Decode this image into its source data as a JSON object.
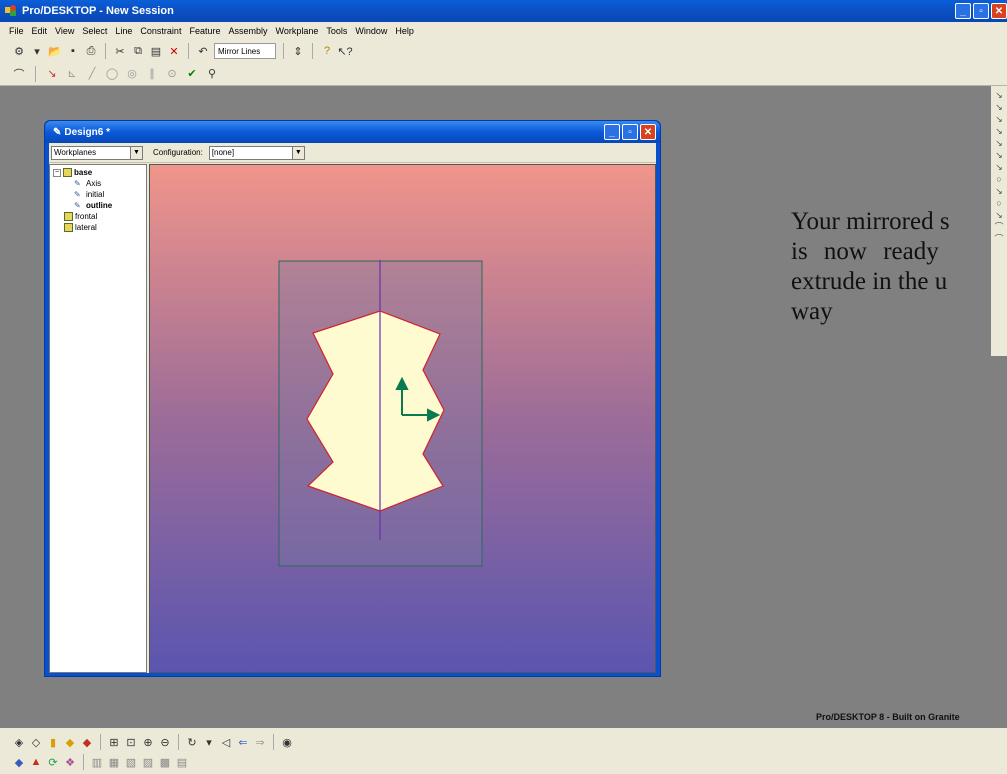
{
  "app": {
    "title": "Pro/DESKTOP - New Session",
    "window_buttons": [
      "minimize",
      "maximize",
      "close"
    ]
  },
  "menu": [
    "File",
    "Edit",
    "View",
    "Select",
    "Line",
    "Constraint",
    "Feature",
    "Assembly",
    "Workplane",
    "Tools",
    "Window",
    "Help"
  ],
  "toolbar": {
    "mirror_label": "Mirror Lines"
  },
  "design_window": {
    "title": "Design6 *",
    "view_select": "Workplanes",
    "config_label": "Configuration:",
    "config_value": "[none]"
  },
  "tree": {
    "items": [
      {
        "label": "base",
        "type": "workplane",
        "level": 0
      },
      {
        "label": "Axis",
        "type": "sketch",
        "level": 1
      },
      {
        "label": "initial",
        "type": "sketch",
        "level": 1
      },
      {
        "label": "outline",
        "type": "sketch",
        "level": 1
      },
      {
        "label": "frontal",
        "type": "workplane",
        "level": 0
      },
      {
        "label": "lateral",
        "type": "workplane",
        "level": 0
      }
    ]
  },
  "note": {
    "lines": [
      "Your mirrored s",
      "is  now  ready",
      "extrude in the u",
      "way"
    ]
  },
  "status": {
    "product": "Pro/DESKTOP 8 - Built on Granite"
  },
  "colors": {
    "canvas_top": "#f0958a",
    "canvas_bottom": "#5a55b0",
    "profile_fill": "#fffbd0",
    "profile_edge": "#d02030",
    "axis_line": "#6a30b0",
    "origin_arrow": "#0a7a50"
  }
}
